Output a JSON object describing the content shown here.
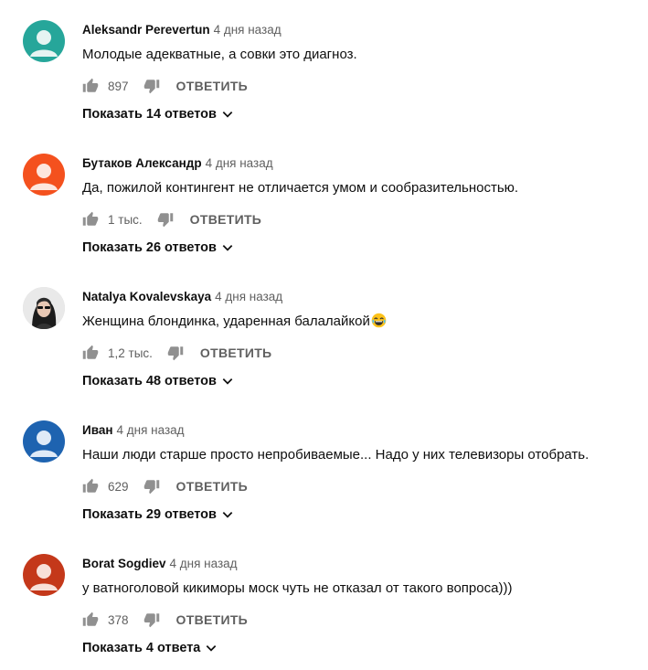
{
  "comments": [
    {
      "author": "Aleksandr Perevertun",
      "time": "4 дня назад",
      "text": "Молодые адекватные, а совки это диагноз.",
      "likes": "897",
      "reply_label": "ОТВЕТИТЬ",
      "show_replies": "Показать 14 ответов",
      "avatar_color": "#26a69a",
      "emoji": ""
    },
    {
      "author": "Бутаков Александр",
      "time": "4 дня назад",
      "text": "Да, пожилой контингент не отличается умом и сообразительностью.",
      "likes": "1 тыс.",
      "reply_label": "ОТВЕТИТЬ",
      "show_replies": "Показать 26 ответов",
      "avatar_color": "#f4511e",
      "emoji": ""
    },
    {
      "author": "Natalya Kovalevskaya",
      "time": "4 дня назад",
      "text": "Женщина блондинка, ударенная балалайкой",
      "likes": "1,2 тыс.",
      "reply_label": "ОТВЕТИТЬ",
      "show_replies": "Показать 48 ответов",
      "avatar_color": "#2b2b2b",
      "emoji": "face-with-tears-of-joy"
    },
    {
      "author": "Иван",
      "time": "4 дня назад",
      "text": "Наши люди старше просто непробиваемые... Надо у них телевизоры отобрать.",
      "likes": "629",
      "reply_label": "ОТВЕТИТЬ",
      "show_replies": "Показать 29 ответов",
      "avatar_color": "#1e63b0",
      "emoji": ""
    },
    {
      "author": "Borat Sogdiev",
      "time": "4 дня назад",
      "text": "у ватноголовой кикиморы моск чуть не отказал от такого вопроса)))",
      "likes": "378",
      "reply_label": "ОТВЕТИТЬ",
      "show_replies": "Показать 4 ответа",
      "avatar_color": "#c4381a",
      "emoji": ""
    }
  ]
}
